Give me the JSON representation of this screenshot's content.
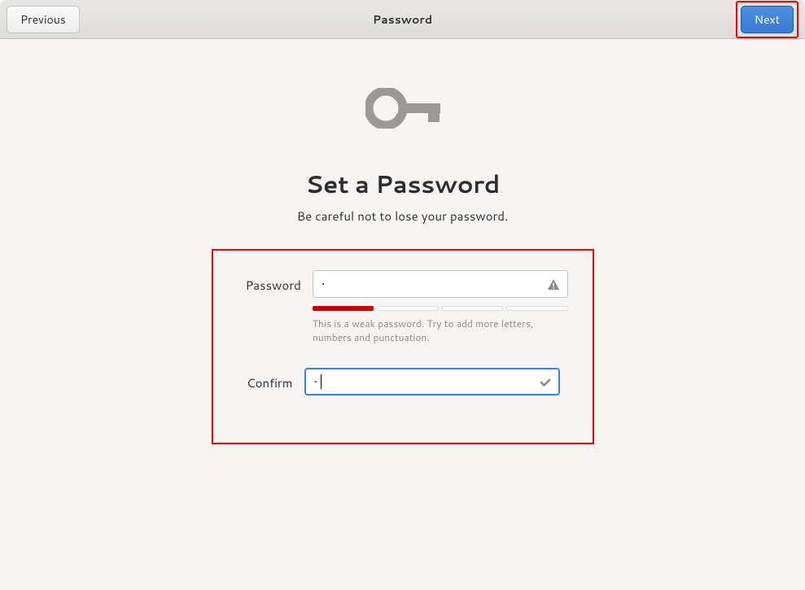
{
  "titlebar": {
    "title": "Password",
    "previous_label": "Previous",
    "next_label": "Next"
  },
  "main": {
    "heading": "Set a Password",
    "subtitle": "Be careful not to lose your password.",
    "password_label": "Password",
    "password_value": "•",
    "confirm_label": "Confirm",
    "confirm_value": "•",
    "hint_text": "This is a weak password. Try to add more letters, numbers and punctuation.",
    "strength_level": 1,
    "strength_segments": 4
  },
  "colors": {
    "accent": "#3584e4",
    "danger": "#cc0000",
    "highlight": "#ff0000"
  }
}
